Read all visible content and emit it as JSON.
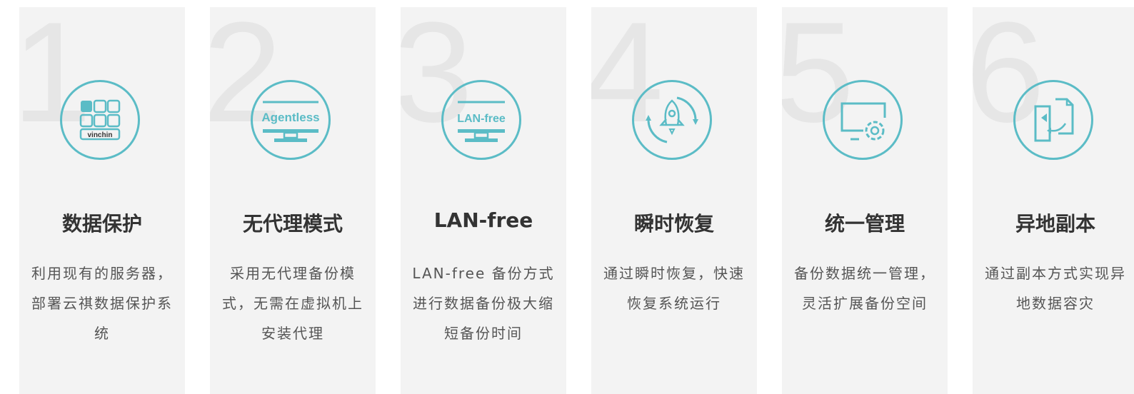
{
  "accent_color": "#5bbcc6",
  "cards": [
    {
      "number": "1",
      "icon": "vinchin-grid-icon",
      "icon_text": "vinchin",
      "title": "数据保护",
      "desc": "利用现有的服务器，部署云祺数据保护系统"
    },
    {
      "number": "2",
      "icon": "agentless-monitor-icon",
      "icon_text": "Agentless",
      "title": "无代理模式",
      "desc": "采用无代理备份模式，无需在虚拟机上安装代理"
    },
    {
      "number": "3",
      "icon": "lan-free-monitor-icon",
      "icon_text": "LAN-free",
      "title": "LAN-free",
      "desc": "LAN-free 备份方式进行数据备份极大缩短备份时间"
    },
    {
      "number": "4",
      "icon": "rocket-restore-icon",
      "title": "瞬时恢复",
      "desc": "通过瞬时恢复，快速恢复系统运行"
    },
    {
      "number": "5",
      "icon": "monitor-gear-icon",
      "title": "统一管理",
      "desc": "备份数据统一管理，灵活扩展备份空间"
    },
    {
      "number": "6",
      "icon": "document-sync-icon",
      "title": "异地副本",
      "desc": "通过副本方式实现异地数据容灾"
    }
  ]
}
